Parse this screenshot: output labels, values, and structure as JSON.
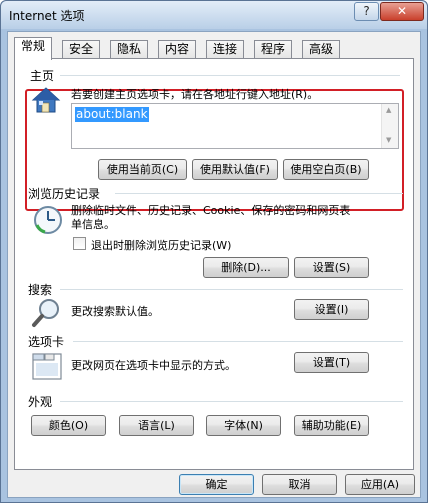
{
  "window": {
    "title": "Internet 选项",
    "help_label": "?",
    "close_label": "✕"
  },
  "tabs": [
    "常规",
    "安全",
    "隐私",
    "内容",
    "连接",
    "程序",
    "高级"
  ],
  "home_page": {
    "group_title": "主页",
    "description": "若要创建主页选项卡，请在各地址行键入地址(R)。",
    "url_value": "about:blank",
    "use_current_label": "使用当前页(C)",
    "use_default_label": "使用默认值(F)",
    "use_blank_label": "使用空白页(B)"
  },
  "browsing_history": {
    "group_title": "浏览历史记录",
    "description": "删除临时文件、历史记录、Cookie、保存的密码和网页表单信息。",
    "delete_on_exit_label": "退出时删除浏览历史记录(W)",
    "delete_on_exit_checked": false,
    "delete_label": "删除(D)...",
    "settings_label": "设置(S)"
  },
  "search": {
    "group_title": "搜索",
    "description": "更改搜索默认值。",
    "settings_label": "设置(I)"
  },
  "tabs_section": {
    "group_title": "选项卡",
    "description": "更改网页在选项卡中显示的方式。",
    "settings_label": "设置(T)"
  },
  "appearance": {
    "group_title": "外观",
    "colors_label": "颜色(O)",
    "languages_label": "语言(L)",
    "fonts_label": "字体(N)",
    "accessibility_label": "辅助功能(E)"
  },
  "footer": {
    "ok_label": "确定",
    "cancel_label": "取消",
    "apply_label": "应用(A)"
  },
  "icons": {
    "home": "house-icon",
    "history": "clock-icon",
    "search": "magnifier-icon",
    "tabs": "tabs-icon"
  },
  "colors": {
    "highlight_border": "#d21f26",
    "selection": "#3399ff"
  }
}
